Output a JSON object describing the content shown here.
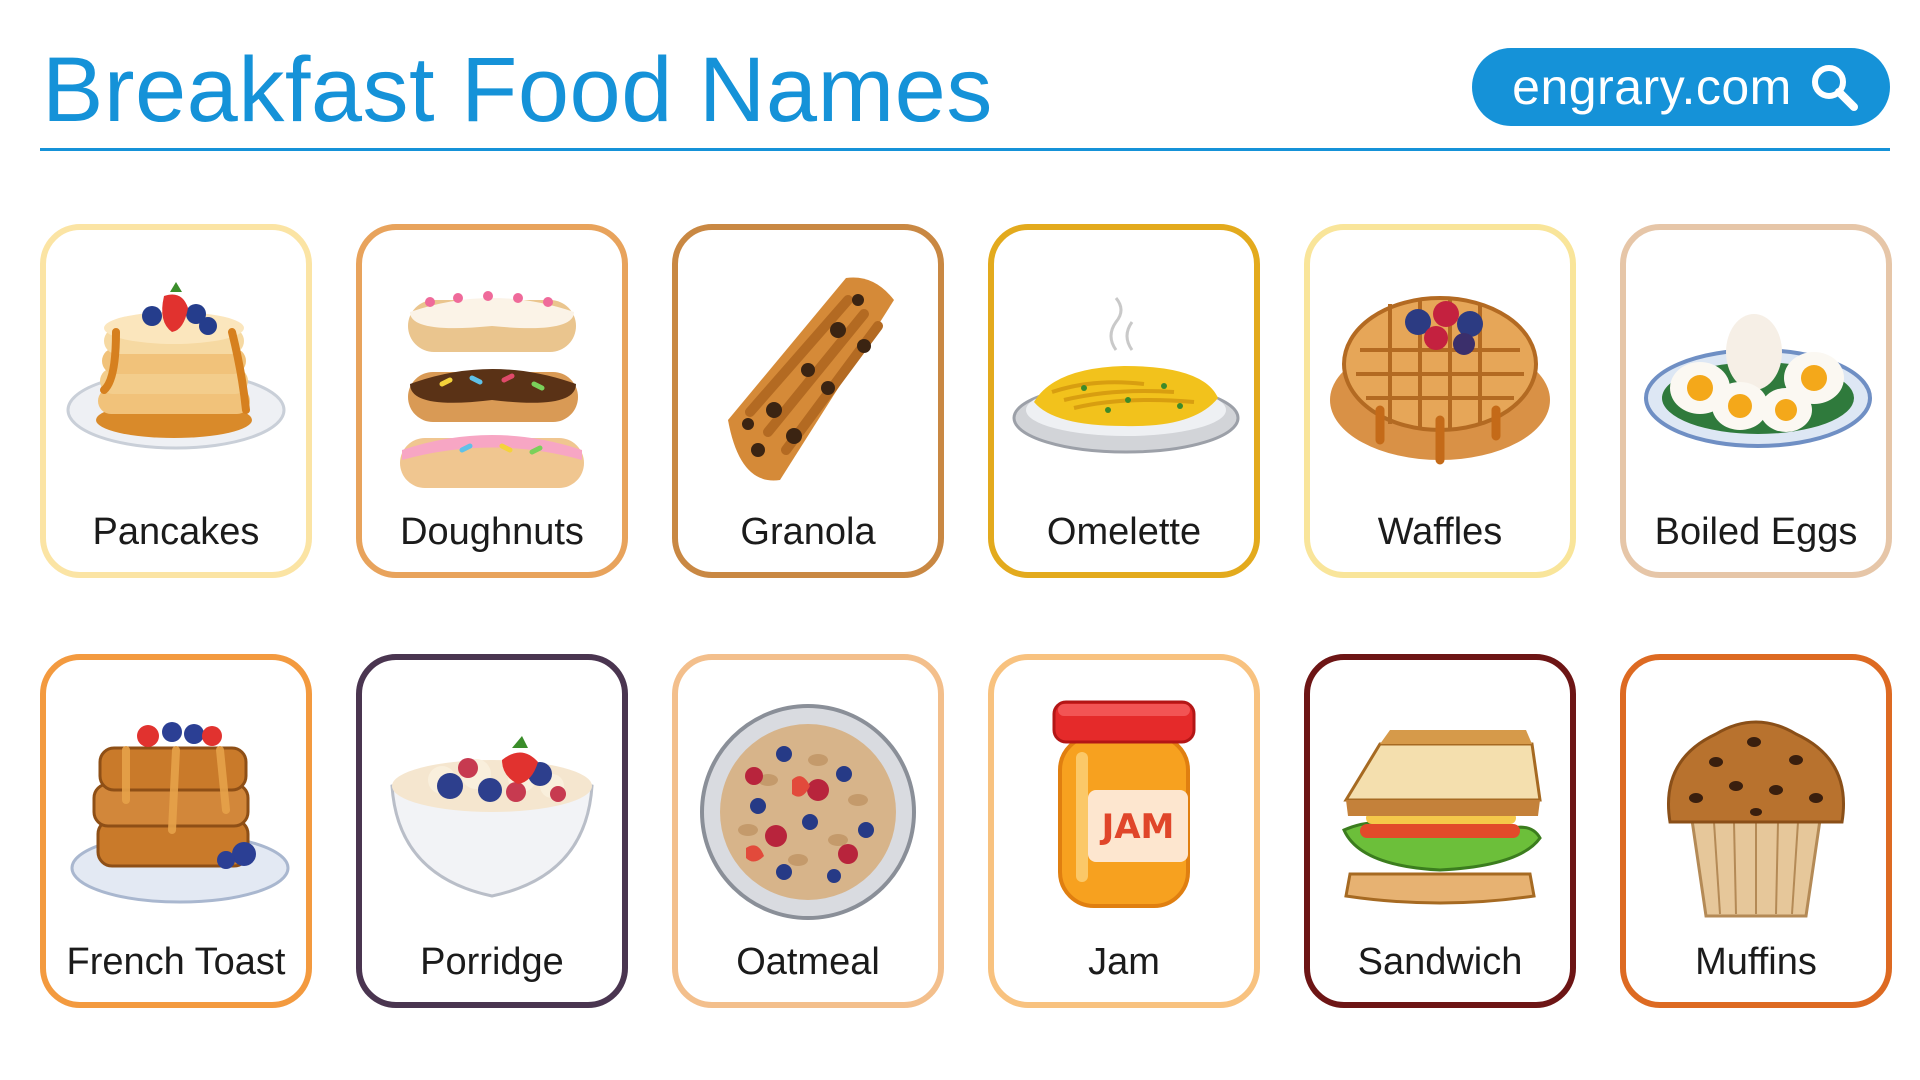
{
  "header": {
    "title": "Breakfast Food Names",
    "site": "engrary.com",
    "accent_color": "#1592d8"
  },
  "cards": [
    {
      "label": "Pancakes",
      "icon": "pancakes-icon",
      "border_color": "#fbe4a4"
    },
    {
      "label": "Doughnuts",
      "icon": "doughnuts-icon",
      "border_color": "#e8a35c"
    },
    {
      "label": "Granola",
      "icon": "granola-icon",
      "border_color": "#c98843"
    },
    {
      "label": "Omelette",
      "icon": "omelette-icon",
      "border_color": "#e3aa1d"
    },
    {
      "label": "Waffles",
      "icon": "waffles-icon",
      "border_color": "#f9e59a"
    },
    {
      "label": "Boiled Eggs",
      "icon": "boiled-eggs-icon",
      "border_color": "#e6c6a8"
    },
    {
      "label": "French Toast",
      "icon": "french-toast-icon",
      "border_color": "#f39a3f"
    },
    {
      "label": "Porridge",
      "icon": "porridge-icon",
      "border_color": "#4a3550"
    },
    {
      "label": "Oatmeal",
      "icon": "oatmeal-icon",
      "border_color": "#f3bf8c"
    },
    {
      "label": "Jam",
      "icon": "jam-icon",
      "border_color": "#f8c27f"
    },
    {
      "label": "Sandwich",
      "icon": "sandwich-icon",
      "border_color": "#6d1515"
    },
    {
      "label": "Muffins",
      "icon": "muffins-icon",
      "border_color": "#dd6a22"
    }
  ]
}
